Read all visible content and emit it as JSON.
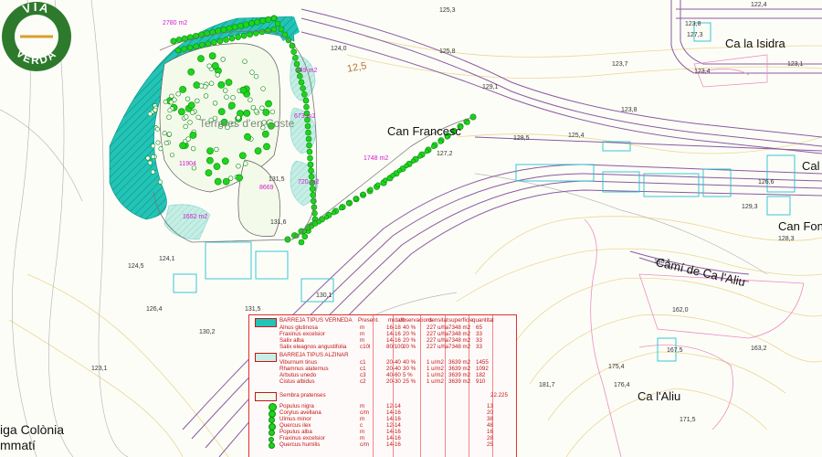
{
  "map": {
    "places": {
      "ca_la_isidra": "Ca la Isidra",
      "can_francesc": "Can Francesc",
      "cal": "Cal",
      "can_fon": "Can Fon",
      "cami_ca_laliu": "Camí de Ca l'Aliu",
      "ca_laliu": "Ca l'Aliu",
      "antiga_colonia": "iga Colònia",
      "antiga_colonia_2": "mmatí",
      "terreres": "Terreres d'en Coste"
    },
    "elevations": [
      "125,3",
      "124,0",
      "125,8",
      "123,7",
      "129,1",
      "122,4",
      "123,8",
      "127,3",
      "123,1",
      "123,4",
      "123,8",
      "125,4",
      "128,5",
      "127,2",
      "126,6",
      "129,3",
      "128,3",
      "124,1",
      "124,5",
      "131,5",
      "131,6",
      "130,1",
      "131,5",
      "126,4",
      "130,2",
      "123,1",
      "148,4",
      "162,0",
      "167,5",
      "163,2",
      "181,7",
      "175,4",
      "171,5",
      "176,4"
    ],
    "areas": {
      "a_top": "2780 m2",
      "a_1": "249 m2",
      "a_2": "673 m2",
      "a_3": "720 m2",
      "a_4": "1748 m2",
      "a_5": "1652 m2",
      "a_6": "11904",
      "a_7": "8669"
    },
    "contour_label": "12,5"
  },
  "legend": {
    "header": [
      "BARREJA TIPUS VERNEDA",
      "Present.",
      "mida/h",
      "observacions",
      "densitat",
      "superfície",
      "quantitat"
    ],
    "section1": [
      [
        "Alnus glutinosa",
        "m",
        "16-18",
        "40 %",
        "227 u/ha",
        "7348 m2",
        "65"
      ],
      [
        "Fraxinus excelsior",
        "m",
        "14-16",
        "20 %",
        "227 u/ha",
        "7348 m2",
        "33"
      ],
      [
        "Salix alba",
        "m",
        "14-16",
        "20 %",
        "227 u/ha",
        "7348 m2",
        "33"
      ],
      [
        "Salix eleagnos angustifolia",
        "c10l",
        "80/100",
        "20 %",
        "227 u/ha",
        "7348 m2",
        "33"
      ]
    ],
    "section2_title": "BARREJA TIPUS ALZINAR",
    "section2": [
      [
        "Viburnum tinus",
        "c1",
        "20-40",
        "40 %",
        "1 u/m2",
        "3639 m2",
        "1455"
      ],
      [
        "Rhamnus alaternus",
        "c1",
        "20-40",
        "30 %",
        "1 u/m2",
        "3639 m2",
        "1092"
      ],
      [
        "Arbutus unedo",
        "c3",
        "40-60",
        "5 %",
        "1 u/m2",
        "3639 m2",
        "182"
      ],
      [
        "Cistus albidus",
        "c2",
        "20-30",
        "25 %",
        "1 u/m2",
        "3639 m2",
        "910"
      ]
    ],
    "sembra": [
      "Sembra pratenses",
      "22.225"
    ],
    "section3": [
      [
        "Populus nigra",
        "m",
        "12-14",
        "13"
      ],
      [
        "Corylus avellana",
        "c/m",
        "14-16",
        "20"
      ],
      [
        "Ulmus minor",
        "m",
        "14-16",
        "38"
      ],
      [
        "Quercus ilex",
        "c",
        "12-14",
        "48"
      ],
      [
        "Populus alba",
        "m",
        "14-16",
        "16"
      ],
      [
        "Fraxinus excelsior",
        "m",
        "14-16",
        "28"
      ],
      [
        "Quercus humilis",
        "c/m",
        "14-16",
        "25"
      ]
    ]
  },
  "logo": {
    "text_top": "VIA",
    "text_bottom": "VERDA",
    "color": "#2d7a2d",
    "accent": "#d9a02a"
  },
  "colors": {
    "green": "#1ed41e",
    "teal": "#1fbfb0",
    "road": "#8a5aa0",
    "contour": "#e8d890"
  }
}
